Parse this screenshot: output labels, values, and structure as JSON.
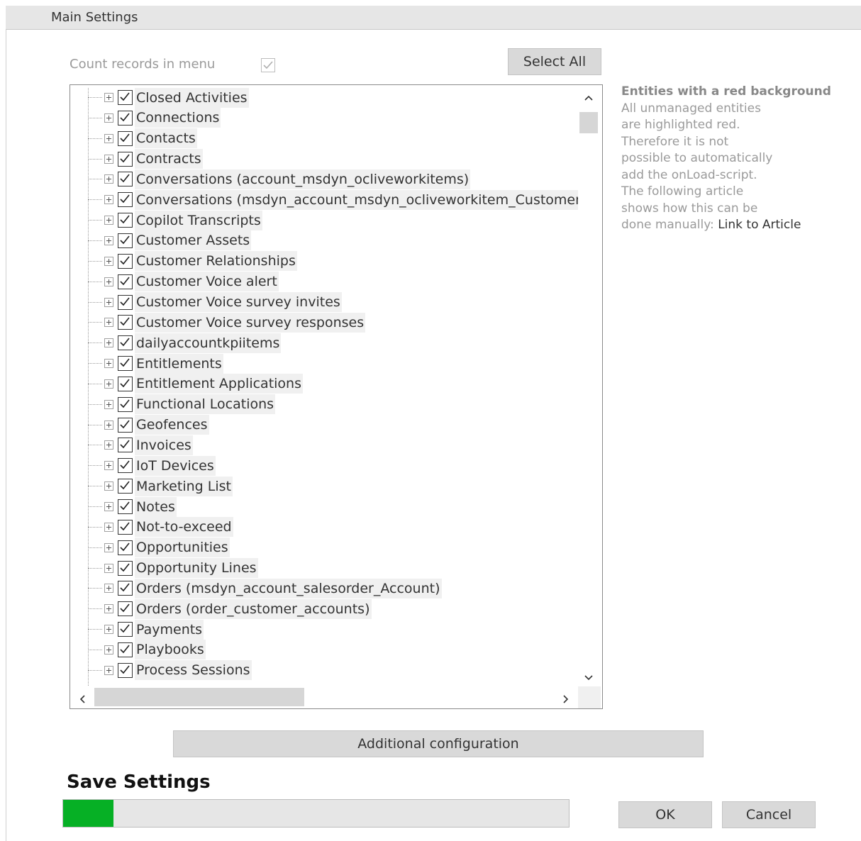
{
  "groupbox": {
    "title": "Main Settings"
  },
  "count_records": {
    "label": "Count records in menu",
    "checked": true
  },
  "select_all_label": "Select All",
  "tree": {
    "items": [
      {
        "label": "Closed Activities",
        "checked": true
      },
      {
        "label": "Connections",
        "checked": true
      },
      {
        "label": "Contacts",
        "checked": true
      },
      {
        "label": "Contracts",
        "checked": true
      },
      {
        "label": "Conversations (account_msdyn_ocliveworkitems)",
        "checked": true
      },
      {
        "label": "Conversations (msdyn_account_msdyn_ocliveworkitem_Customer)",
        "checked": true
      },
      {
        "label": "Copilot Transcripts",
        "checked": true
      },
      {
        "label": "Customer Assets",
        "checked": true
      },
      {
        "label": "Customer Relationships",
        "checked": true
      },
      {
        "label": "Customer Voice alert",
        "checked": true
      },
      {
        "label": "Customer Voice survey invites",
        "checked": true
      },
      {
        "label": "Customer Voice survey responses",
        "checked": true
      },
      {
        "label": "dailyaccountkpiitems",
        "checked": true
      },
      {
        "label": "Entitlements",
        "checked": true
      },
      {
        "label": "Entitlement Applications",
        "checked": true
      },
      {
        "label": "Functional Locations",
        "checked": true
      },
      {
        "label": "Geofences",
        "checked": true
      },
      {
        "label": "Invoices",
        "checked": true
      },
      {
        "label": "IoT Devices",
        "checked": true
      },
      {
        "label": "Marketing List",
        "checked": true
      },
      {
        "label": "Notes",
        "checked": true
      },
      {
        "label": "Not-to-exceed",
        "checked": true
      },
      {
        "label": "Opportunities",
        "checked": true
      },
      {
        "label": "Opportunity Lines",
        "checked": true
      },
      {
        "label": "Orders (msdyn_account_salesorder_Account)",
        "checked": true
      },
      {
        "label": "Orders (order_customer_accounts)",
        "checked": true
      },
      {
        "label": "Payments",
        "checked": true
      },
      {
        "label": "Playbooks",
        "checked": true
      },
      {
        "label": "Process Sessions",
        "checked": true
      }
    ],
    "icons": {
      "scroll_up": "chevron-up-icon",
      "scroll_down": "chevron-down-icon",
      "scroll_left": "chevron-left-icon",
      "scroll_right": "chevron-right-icon"
    }
  },
  "info": {
    "title": "Entities with a red background",
    "lines": [
      "All unmanaged entities",
      "are highlighted red.",
      "Therefore it is not",
      "possible to automatically",
      "add the onLoad-script.",
      "The following article",
      "shows how this can be"
    ],
    "last_line_prefix": "done manually: ",
    "link_text": "Link to Article"
  },
  "additional_config_label": "Additional configuration",
  "save": {
    "title": "Save Settings",
    "progress_fraction": 0.1,
    "progress_color": "#06b025"
  },
  "ok_label": "OK",
  "cancel_label": "Cancel"
}
